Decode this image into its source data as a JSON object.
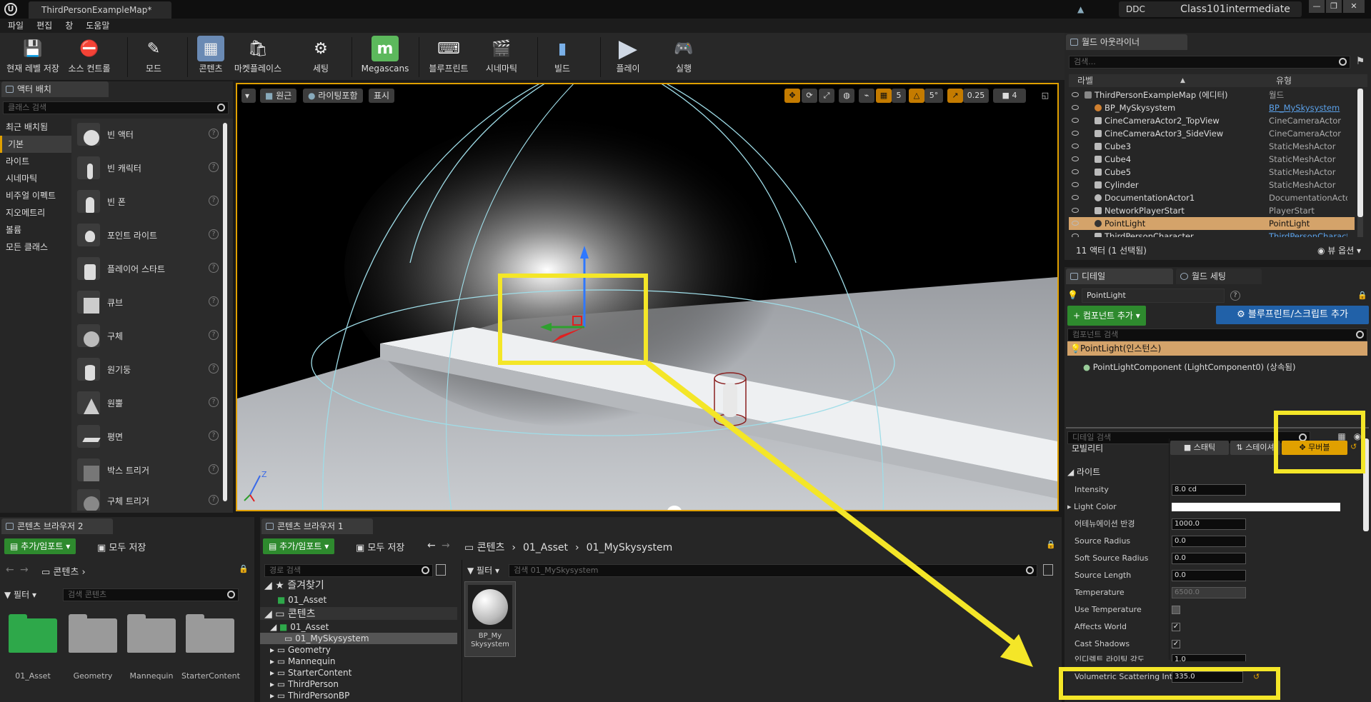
{
  "window": {
    "tab_title": "ThirdPersonExampleMap*",
    "ddc": "DDC",
    "project": "Class101intermediate",
    "min": "—",
    "max": "❐",
    "close": "✕"
  },
  "menu": [
    "파일",
    "편집",
    "창",
    "도움말"
  ],
  "toolbar": [
    {
      "label": "현재 레벨 저장",
      "icon": "save-icon"
    },
    {
      "label": "소스 컨트롤",
      "icon": "source-control-icon"
    },
    {
      "label": "모드",
      "icon": "modes-icon"
    },
    {
      "label": "콘텐츠",
      "icon": "content-icon"
    },
    {
      "label": "마켓플레이스",
      "icon": "marketplace-icon"
    },
    {
      "label": "세팅",
      "icon": "settings-icon"
    },
    {
      "label": "Megascans",
      "icon": "megascans-icon"
    },
    {
      "label": "블루프린트",
      "icon": "blueprint-icon"
    },
    {
      "label": "시네마틱",
      "icon": "cinematics-icon"
    },
    {
      "label": "빌드",
      "icon": "build-icon"
    },
    {
      "label": "플레이",
      "icon": "play-icon"
    },
    {
      "label": "실행",
      "icon": "launch-icon"
    }
  ],
  "place_actors": {
    "tab": "액터 배치",
    "search_placeholder": "클래스 검색",
    "categories": [
      {
        "label": "최근 배치됨"
      },
      {
        "label": "기본",
        "selected": true
      },
      {
        "label": "라이트"
      },
      {
        "label": "시네마틱"
      },
      {
        "label": "비주얼 이펙트"
      },
      {
        "label": "지오메트리"
      },
      {
        "label": "볼륨"
      },
      {
        "label": "모든 클래스"
      }
    ],
    "items": [
      "빈 액터",
      "빈 캐릭터",
      "빈 폰",
      "포인트 라이트",
      "플레이어 스타트",
      "큐브",
      "구체",
      "원기둥",
      "원뿔",
      "평면",
      "박스 트리거",
      "구체 트리거"
    ]
  },
  "viewport": {
    "perspective": "원근",
    "lighting": "라이팅포함",
    "show": "표시",
    "grid": "5",
    "angle": "5°",
    "scale": "0.25",
    "camspeed": "4"
  },
  "outliner": {
    "tab": "월드 아웃라이너",
    "search_placeholder": "검색...",
    "col_label": "라벨",
    "col_type": "유형",
    "rows": [
      {
        "name": "ThirdPersonExampleMap (에디터)",
        "type": "월드",
        "level": 0
      },
      {
        "name": "BP_MySkysystem",
        "type": "BP_MySkysystem",
        "link": true
      },
      {
        "name": "CineCameraActor2_TopView",
        "type": "CineCameraActor"
      },
      {
        "name": "CineCameraActor3_SideView",
        "type": "CineCameraActor"
      },
      {
        "name": "Cube3",
        "type": "StaticMeshActor"
      },
      {
        "name": "Cube4",
        "type": "StaticMeshActor"
      },
      {
        "name": "Cube5",
        "type": "StaticMeshActor"
      },
      {
        "name": "Cylinder",
        "type": "StaticMeshActor"
      },
      {
        "name": "DocumentationActor1",
        "type": "DocumentationActor"
      },
      {
        "name": "NetworkPlayerStart",
        "type": "PlayerStart"
      },
      {
        "name": "PointLight",
        "type": "PointLight",
        "selected": true
      },
      {
        "name": "ThirdPersonCharacter",
        "type": "ThirdPersonCharacter",
        "link": true
      }
    ],
    "status": "11 액터 (1 선택됨)",
    "view_options": "뷰 옵션"
  },
  "details": {
    "tab": "디테일",
    "tab2": "월드 세팅",
    "name": "PointLight",
    "add_component": "컴포넌트 추가",
    "blueprint_btn": "블루프린트/스크립트 추가",
    "comp_search": "컴포넌트 검색",
    "instance": "PointLight(인스턴스)",
    "component": "PointLightComponent (LightComponent0) (상속됨)",
    "detail_search": "디테일 검색",
    "mobility_label": "모빌리티",
    "mob_static": "스태틱",
    "mob_stationary": "스테이셔",
    "mob_movable": "무버블",
    "section_light": "라이트",
    "props": [
      {
        "label": "Intensity",
        "value": "8.0 cd",
        "kind": "num"
      },
      {
        "label": "Light Color",
        "kind": "color"
      },
      {
        "label": "어테뉴에이션 반경",
        "value": "1000.0",
        "kind": "num"
      },
      {
        "label": "Source Radius",
        "value": "0.0",
        "kind": "num"
      },
      {
        "label": "Soft Source Radius",
        "value": "0.0",
        "kind": "num"
      },
      {
        "label": "Source Length",
        "value": "0.0",
        "kind": "num"
      },
      {
        "label": "Temperature",
        "value": "6500.0",
        "kind": "dis"
      },
      {
        "label": "Use Temperature",
        "kind": "chk",
        "checked": false
      },
      {
        "label": "Affects World",
        "kind": "chk",
        "checked": true
      },
      {
        "label": "Cast Shadows",
        "kind": "chk",
        "checked": true
      },
      {
        "label": "인디렉트 라이팅 강도",
        "value": "1.0",
        "kind": "num"
      },
      {
        "label": "Volumetric Scattering Int",
        "value": "335.0",
        "kind": "num"
      }
    ]
  },
  "cb2": {
    "tab": "콘텐츠 브라우저 2",
    "add": "추가/임포트",
    "save_all": "모두 저장",
    "path": "콘텐츠",
    "filter": "필터",
    "search_placeholder": "검색 콘텐츠",
    "folders": [
      {
        "label": "01_Asset",
        "color": "#2ea84a"
      },
      {
        "label": "Geometry",
        "color": "#9a9a9a"
      },
      {
        "label": "Mannequin",
        "color": "#9a9a9a"
      },
      {
        "label": "StarterContent",
        "color": "#9a9a9a"
      }
    ]
  },
  "cb1": {
    "tab": "콘텐츠 브라우저 1",
    "add": "추가/임포트",
    "save_all": "모두 저장",
    "crumbs": [
      "콘텐츠",
      "01_Asset",
      "01_MySkysystem"
    ],
    "path_search": "경로 검색",
    "favorites": "즐겨찾기",
    "fav_item": "01_Asset",
    "content": "콘텐츠",
    "tree": [
      "01_Asset",
      "01_MySkysystem",
      "Geometry",
      "Mannequin",
      "StarterContent",
      "ThirdPerson",
      "ThirdPersonBP"
    ],
    "filter": "필터",
    "search_placeholder": "검색 01_MySkysystem",
    "asset": "BP_My Skysystem"
  },
  "colors": {
    "accent": "#e0a000",
    "highlight": "#f4e628",
    "green": "#2e8a2e",
    "blue": "#2161a8"
  }
}
